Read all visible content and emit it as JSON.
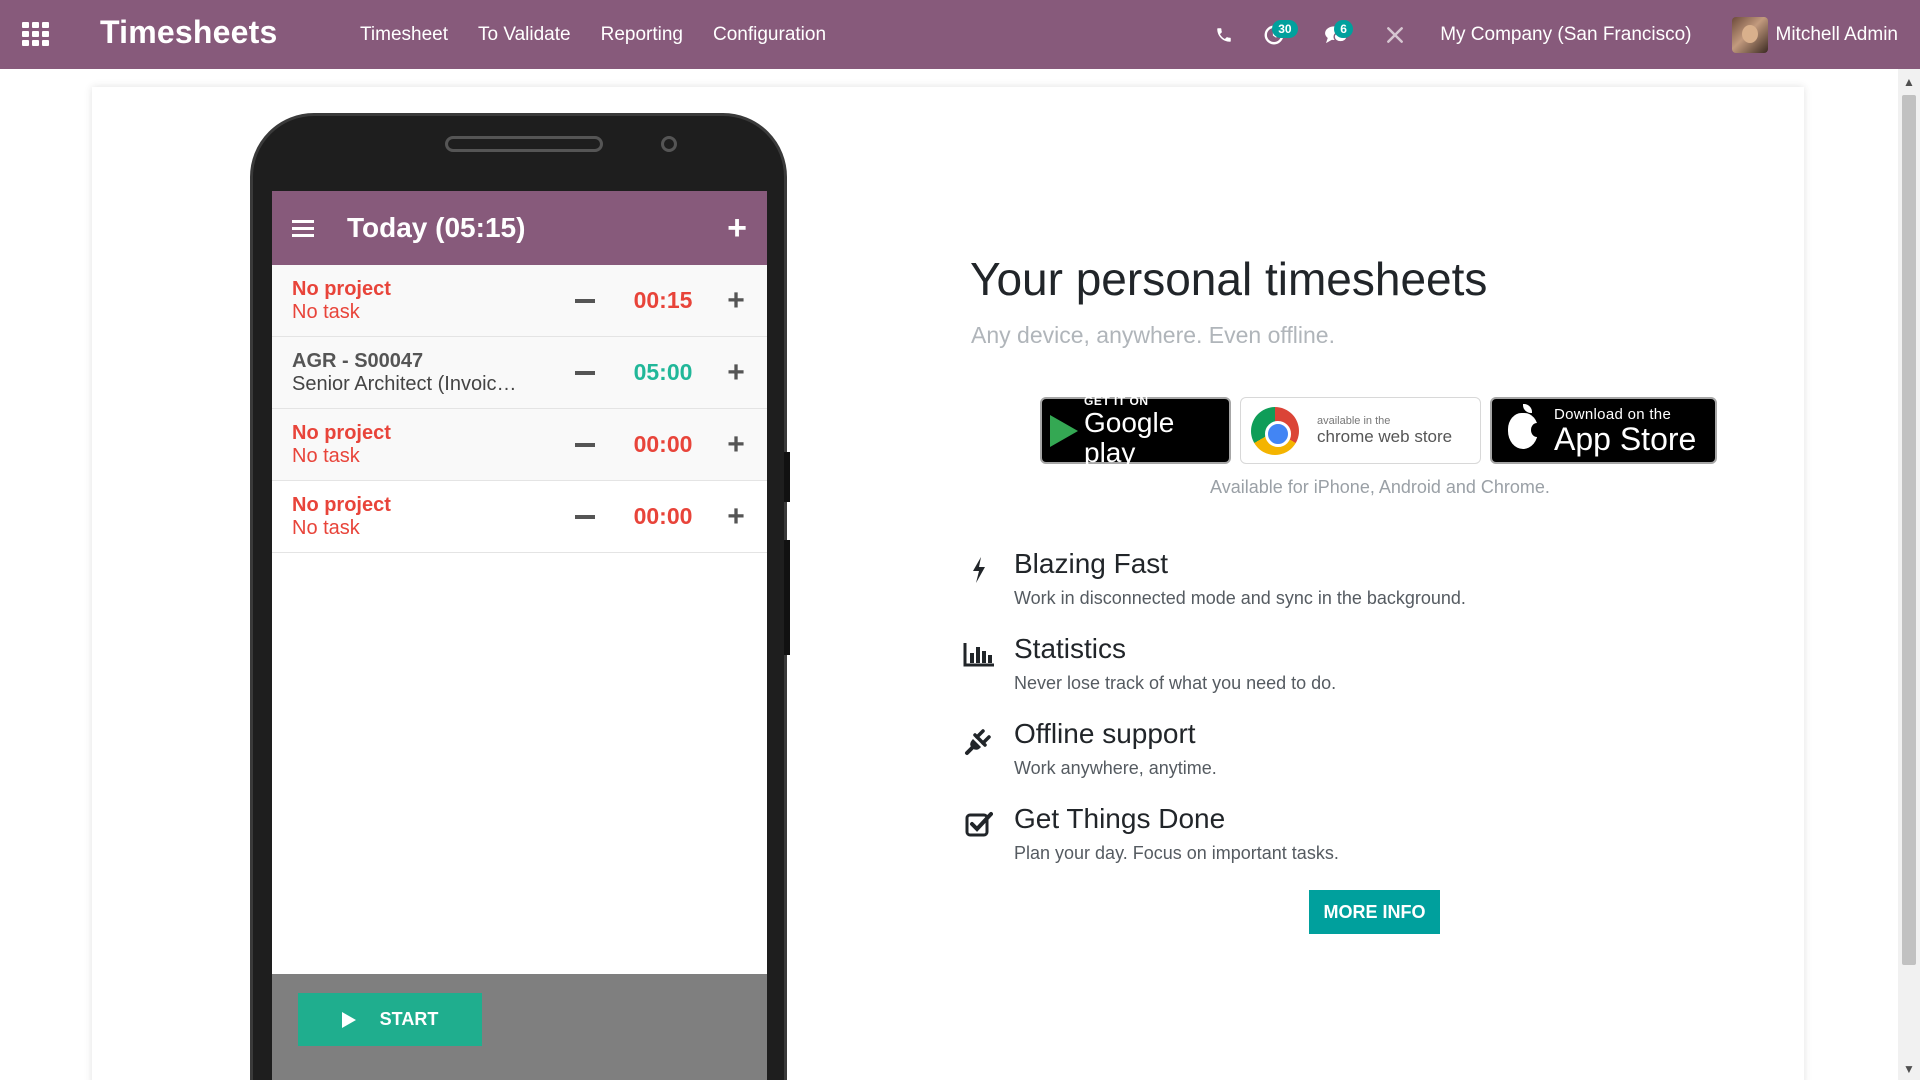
{
  "navbar": {
    "brand": "Timesheets",
    "menu": [
      "Timesheet",
      "To Validate",
      "Reporting",
      "Configuration"
    ],
    "activity_count": "30",
    "messages_count": "6",
    "company": "My Company (San Francisco)",
    "user": "Mitchell Admin",
    "color": "#875a7b"
  },
  "phone": {
    "header_title": "Today (05:15)",
    "entries": [
      {
        "project": "No project",
        "task": "No task",
        "time": "00:15"
      },
      {
        "project": "AGR - S00047",
        "task": "Senior Architect (Invoic…",
        "time": "05:00"
      },
      {
        "project": "No project",
        "task": "No task",
        "time": "00:00"
      },
      {
        "project": "No project",
        "task": "No task",
        "time": "00:00"
      }
    ],
    "start_label": "START"
  },
  "hero": {
    "title": "Your personal timesheets",
    "subtitle": "Any device, anywhere. Even offline."
  },
  "stores": {
    "google_top": "GET IT ON",
    "google_main": "Google play",
    "chrome_top": "available in the",
    "chrome_main": "chrome web store",
    "apple_top": "Download on the",
    "apple_main": "App Store",
    "available_note": "Available for iPhone, Android and Chrome."
  },
  "features": [
    {
      "title": "Blazing Fast",
      "desc": "Work in disconnected mode and sync in the background."
    },
    {
      "title": "Statistics",
      "desc": "Never lose track of what you need to do."
    },
    {
      "title": "Offline support",
      "desc": "Work anywhere, anytime."
    },
    {
      "title": "Get Things Done",
      "desc": "Plan your day. Focus on important tasks."
    }
  ],
  "more_info_label": "MORE INFO",
  "icons": [
    "apps-icon",
    "phone-icon",
    "clock-icon",
    "chat-icon",
    "tools-icon",
    "bolt-icon",
    "bar-chart-icon",
    "plug-icon",
    "checkbox-icon",
    "play-icon"
  ]
}
